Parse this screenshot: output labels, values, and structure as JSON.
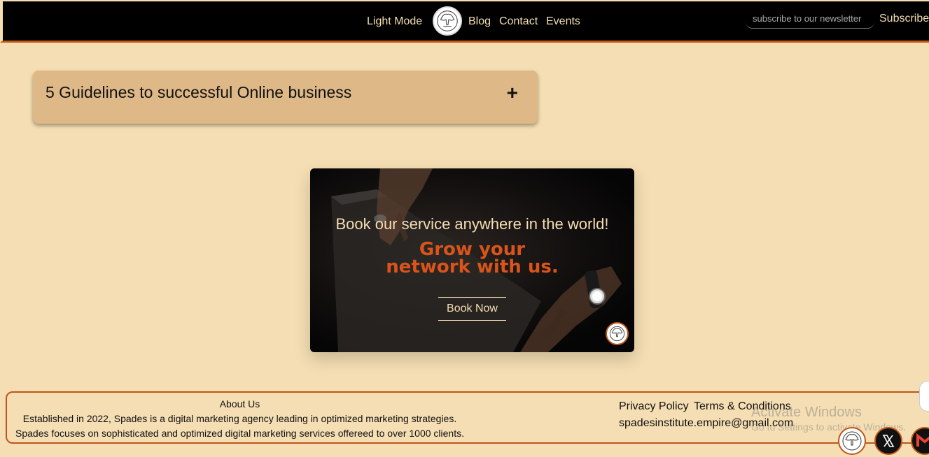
{
  "header": {
    "nav": {
      "light_mode": "Light Mode",
      "blog": "Blog",
      "contact": "Contact",
      "events": "Events"
    },
    "newsletter_placeholder": "subscribe to our newsletter",
    "subscribe_label": "Subscribe"
  },
  "accordion": {
    "title": "5 Guidelines to successful Online business",
    "toggle_symbol": "+"
  },
  "promo": {
    "heading": "Book our service anywhere in the world!",
    "sub_line1": "Grow your",
    "sub_line2": "network with us.",
    "button_label": "Book Now"
  },
  "footer": {
    "about_title": "About Us",
    "about_line1": "Established in 2022, Spades is a digital marketing agency leading in optimized marketing strategies.",
    "about_line2": "Spades focuses on sophisticated and optimized digital marketing services offereed to over 1000 clients.",
    "privacy_label": "Privacy Policy",
    "terms_label": "Terms & Conditions",
    "email": "spadesinstitute.empire@gmail.com"
  },
  "watermark": {
    "title": "Activate Windows",
    "subtitle": "Go to Settings to activate Windows."
  },
  "colors": {
    "background": "#f5deb3",
    "header": "#000000",
    "accent": "#c0561a",
    "accordion": "#deb887",
    "promo_sub": "#d9541a"
  },
  "icons": {
    "logo": "spade-tree-logo-icon",
    "social": [
      "spade-tree-logo-icon",
      "x-icon",
      "gmail-icon"
    ]
  }
}
